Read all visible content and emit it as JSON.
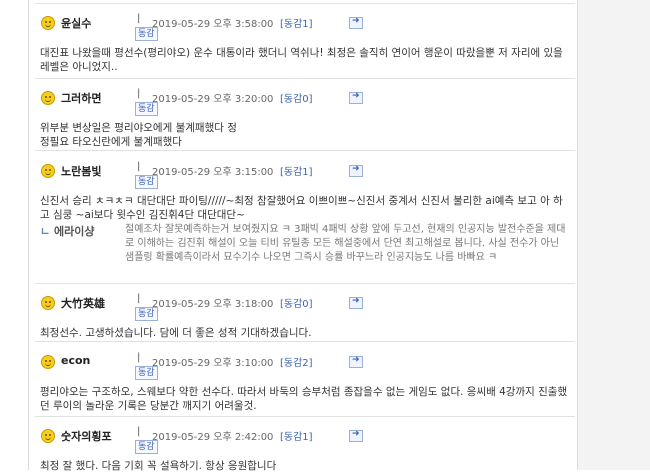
{
  "comments": [
    {
      "nick": "윤실수",
      "separator": "|",
      "date": "2019-05-29 오후 3:58:00",
      "symbol": "[동감1]",
      "empathy": "동감",
      "body": "대진표 나왔을때 평선수(평리야오) 운수 대통이라 했더니 역쉬나! 최정은 솔직히 연이어 행운이 따랐을뿐 저 자리에 있을 레벨은 아니었지.."
    },
    {
      "nick": "그러하면",
      "separator": "|",
      "date": "2019-05-29 오후 3:20:00",
      "symbol": "[동감0]",
      "empathy": "동감",
      "body": "위부분 변상일은 평리야오에게 불계패했다 정정필요 타오신란에게 불계패했다"
    },
    {
      "nick": "노란봄빛",
      "separator": "|",
      "date": "2019-05-29 오후 3:15:00",
      "symbol": "[동감1]",
      "empathy": "동감",
      "body": "신진서 승리 ㅊㅋㅊㅋ 대단대단 파이팅/////~최정 참잘했어요 이쁘이쁘~신진서 중계서 신진서 불리한 ai예측 보고 아 하고 심쿵 ~ai보다 윗수인 김진휘4단 대단대단~",
      "reply": {
        "mark": "ㄴ",
        "nick": "에라이샹",
        "body": "절예조차 잘못예측하는거 보여줬지요 ㅋ 3패빅 4패빅 상황 앞에 두고선, 현재의 인공지능 발전수준을 제대로 이해하는 김진휘 해설이 오늘 티비 유틸종 모든 해설중에서 단연 최고해설로 봅니다. 사실 전수가 아닌 샘플링 확률예측이라서 묘수기수 나오면 그즉시 승률 바꾸느라 인공지능도 나름 바빠요 ㅋ"
      }
    },
    {
      "nick": "大竹英雄",
      "separator": "|",
      "date": "2019-05-29 오후 3:18:00",
      "symbol": "[동감0]",
      "empathy": "동감",
      "body": "최정선수. 고생하셨습니다. 담에 더 좋은 성적 기대하겠습니다."
    },
    {
      "nick": "econ",
      "separator": "|",
      "date": "2019-05-29 오후 3:10:00",
      "symbol": "[동감2]",
      "empathy": "동감",
      "body": "평리야오는 구조하오, 스웨보다 약한 선수다. 따라서 바둑의 승부처럼 종잡을수 없는 게임도 없다. 응씨배 4강까지 진출했던 루이의 놀라운 기록은 당분간 깨지기 어려울것."
    },
    {
      "nick": "숫자의횡포",
      "separator": "|",
      "date": "2019-05-29 오후 2:42:00",
      "symbol": "[동감1]",
      "empathy": "동감",
      "body": "최정 잘 했다. 다음 기회 꼭 설욕하기. 항상 응원합니다"
    }
  ]
}
